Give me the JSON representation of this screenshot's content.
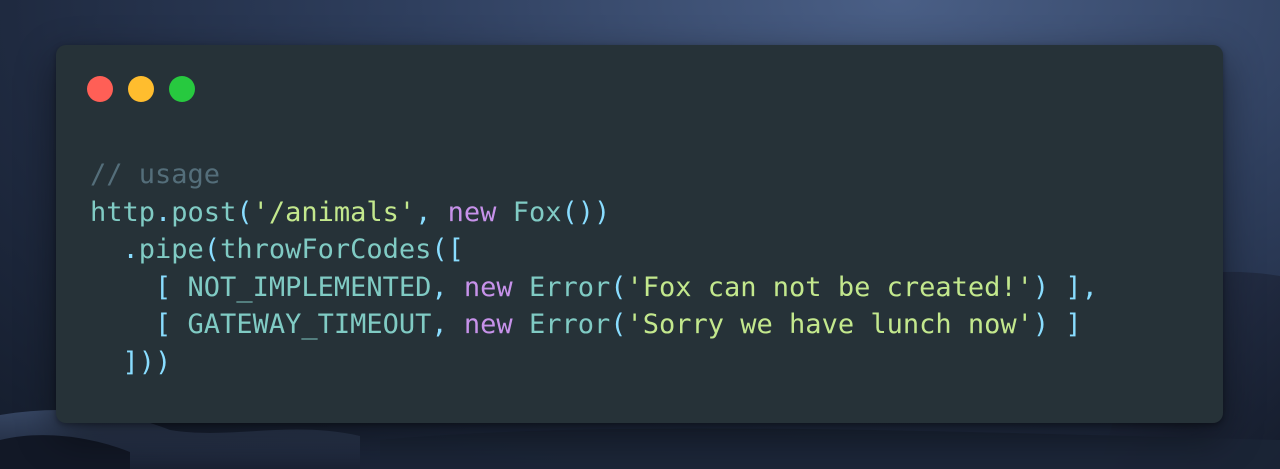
{
  "window": {
    "buttons": {
      "close": "close-button",
      "minimize": "minimize-button",
      "zoom": "zoom-button"
    }
  },
  "code": {
    "line1": {
      "comment": "// usage"
    },
    "line2": {
      "obj": "http",
      "dot": ".",
      "method": "post",
      "open": "(",
      "str": "'/animals'",
      "comma": ", ",
      "kw": "new",
      "space": " ",
      "cls": "Fox",
      "close": "())"
    },
    "line3": {
      "indent": "  ",
      "dot": ".",
      "method": "pipe",
      "open": "(",
      "fn": "throwForCodes",
      "open2": "(["
    },
    "line4": {
      "indent": "    ",
      "open": "[ ",
      "const": "NOT_IMPLEMENTED",
      "comma": ", ",
      "kw": "new",
      "space": " ",
      "cls": "Error",
      "paren": "(",
      "str": "'Fox can not be created!'",
      "close": ") ],"
    },
    "line5": {
      "indent": "    ",
      "open": "[ ",
      "const": "GATEWAY_TIMEOUT",
      "comma": ", ",
      "kw": "new",
      "space": " ",
      "cls": "Error",
      "paren": "(",
      "str": "'Sorry we have lunch now'",
      "close": ") ]"
    },
    "line6": {
      "indent": "  ",
      "close": "]))"
    }
  },
  "colors": {
    "editor_bg": "#263238",
    "comment": "#546e7a",
    "identifier": "#80cbc4",
    "punctuation": "#89ddff",
    "string": "#c3e88d",
    "keyword": "#c792ea",
    "close": "#ff5f56",
    "minimize": "#ffbd2e",
    "zoom": "#27c93f"
  }
}
